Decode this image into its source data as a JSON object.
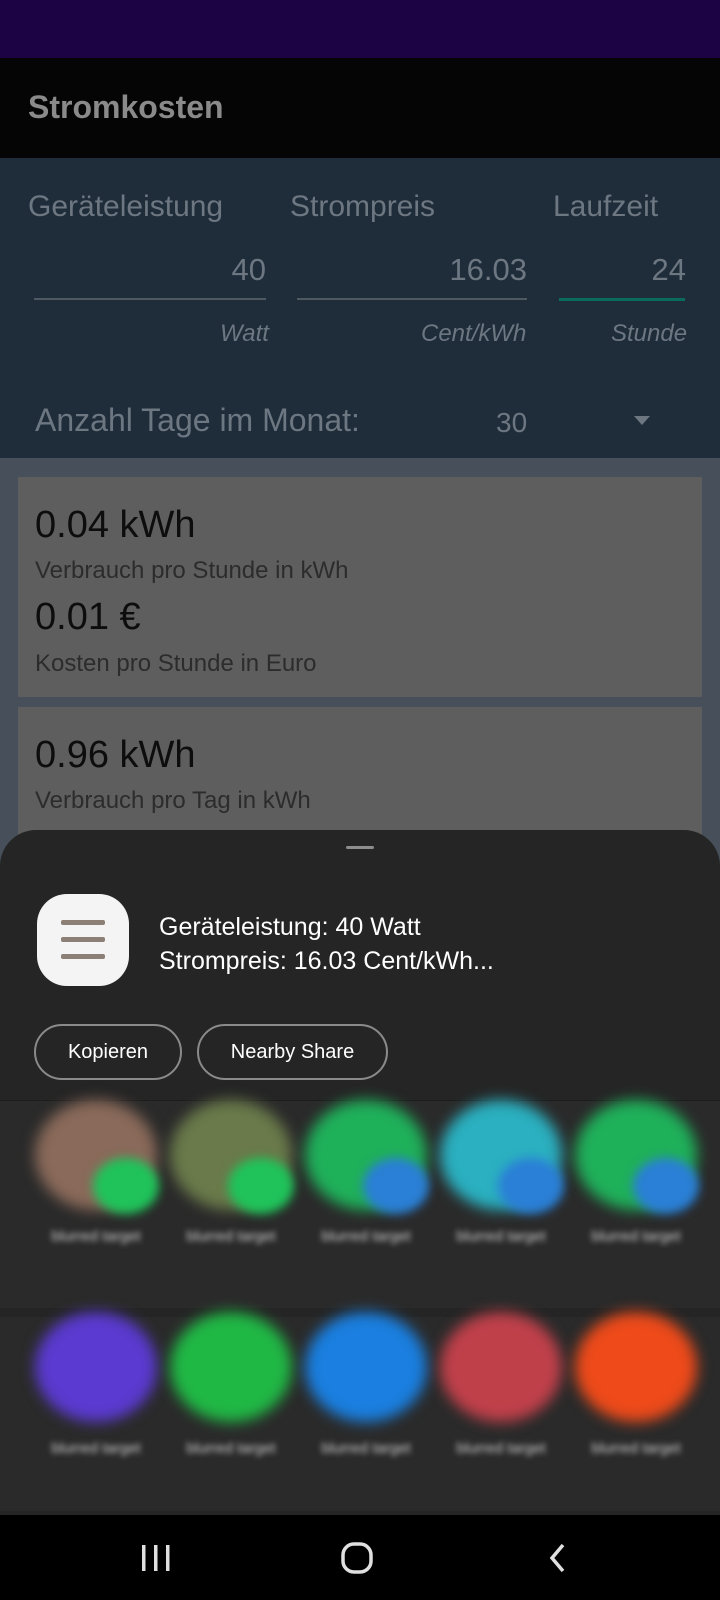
{
  "app": {
    "title": "Stromkosten",
    "colors": {
      "status_bar": "#1b0344",
      "app_bar": "#050505",
      "panel": "#1f2c3a",
      "accent_underline": "#0b6b5a"
    },
    "inputs": [
      {
        "label": "Geräteleistung",
        "value": "40",
        "unit": "Watt"
      },
      {
        "label": "Strompreis",
        "value": "16.03",
        "unit": "Cent/kWh"
      },
      {
        "label": "Laufzeit",
        "value": "24",
        "unit": "Stunde"
      }
    ],
    "days": {
      "label": "Anzahl Tage im Monat:",
      "value": "30"
    },
    "results": [
      {
        "value1": "0.04 kWh",
        "label1": "Verbrauch pro Stunde in kWh",
        "value2": "0.01 €",
        "label2": "Kosten pro Stunde in Euro"
      },
      {
        "value1": "0.96 kWh",
        "label1": "Verbrauch pro Tag in kWh"
      }
    ]
  },
  "share_sheet": {
    "preview_line1": "Geräteleistung: 40 Watt",
    "preview_line2": "Strompreis: 16.03 Cent/kWh...",
    "buttons": {
      "copy": "Kopieren",
      "nearby": "Nearby Share"
    },
    "targets_row1": [
      {
        "color": "#8a6a5a",
        "badge": "#1fc35a",
        "label": "blurred target"
      },
      {
        "color": "#6a7a4a",
        "badge": "#1fc35a",
        "label": "blurred target"
      },
      {
        "color": "#1fb05a",
        "badge": "#2a7fd6",
        "label": "blurred target"
      },
      {
        "color": "#2ab0c0",
        "badge": "#2a7fd6",
        "label": "blurred target"
      },
      {
        "color": "#1fb05a",
        "badge": "#2a7fd6",
        "label": "blurred target"
      }
    ],
    "targets_row2": [
      {
        "color": "#5a3ad0",
        "label": "blurred target"
      },
      {
        "color": "#20b845",
        "label": "blurred target"
      },
      {
        "color": "#1a7fe0",
        "label": "blurred target"
      },
      {
        "color": "#c0404a",
        "label": "blurred target"
      },
      {
        "color": "#ee4a1a",
        "label": "blurred target"
      }
    ]
  },
  "nav": {
    "recents": "recents-icon",
    "home": "home-icon",
    "back": "back-icon"
  }
}
